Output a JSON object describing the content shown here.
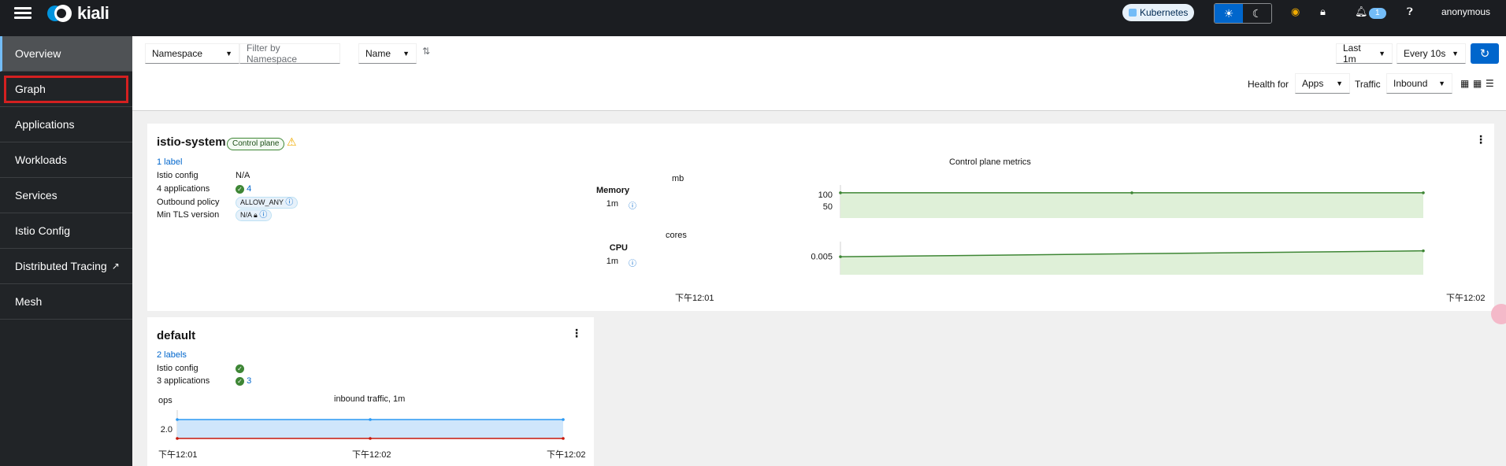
{
  "masthead": {
    "brand": "kiali",
    "cluster_badge": "Kubernetes",
    "notifications_count": "1",
    "username": "anonymous",
    "icons": [
      "menu-icon",
      "sun-icon",
      "moon-icon",
      "status-icon",
      "lock-icon",
      "bell-icon",
      "help-icon"
    ]
  },
  "sidebar": {
    "items": [
      {
        "label": "Overview"
      },
      {
        "label": "Graph"
      },
      {
        "label": "Applications"
      },
      {
        "label": "Workloads"
      },
      {
        "label": "Services"
      },
      {
        "label": "Istio Config"
      },
      {
        "label": "Distributed Tracing"
      },
      {
        "label": "Mesh"
      }
    ],
    "active": "Overview"
  },
  "toolbar": {
    "filter_type": "Namespace",
    "filter_placeholder": "Filter by Namespace",
    "sort_by": "Name",
    "time_range": "Last 1m",
    "refresh_interval": "Every 10s",
    "health_for_label": "Health for",
    "health_for_value": "Apps",
    "traffic_label": "Traffic",
    "traffic_value": "Inbound"
  },
  "cards": {
    "istio_system": {
      "name": "istio-system",
      "badge": "Control plane",
      "labels_link": "1 label",
      "istio_config_label": "Istio config",
      "istio_config_value": "N/A",
      "applications_label": "4 applications",
      "applications_value": "4",
      "outbound_policy_label": "Outbound policy",
      "outbound_policy_value": "ALLOW_ANY",
      "min_tls_label": "Min TLS version",
      "min_tls_value": "N/A",
      "chart_title": "Control plane metrics",
      "memory_label": "Memory",
      "memory_period": "1m",
      "memory_unit": "mb",
      "cpu_label": "CPU",
      "cpu_period": "1m",
      "cpu_unit": "cores",
      "x_start": "下午12:01",
      "x_end": "下午12:02"
    },
    "default": {
      "name": "default",
      "labels_link": "2 labels",
      "istio_config_label": "Istio config",
      "applications_label": "3 applications",
      "applications_value": "3",
      "chart_title": "inbound traffic, 1m",
      "y_unit": "ops",
      "x_start": "下午12:01",
      "x_mid": "下午12:02",
      "x_end": "下午12:02"
    }
  },
  "chart_data": [
    {
      "type": "area",
      "title": "Memory",
      "ylabel": "mb",
      "y_ticks": [
        "100",
        "50"
      ],
      "ylim": [
        0,
        140
      ],
      "x": [
        "下午12:01",
        "下午12:02"
      ],
      "series": [
        {
          "values": [
            107,
            107,
            107
          ]
        }
      ],
      "color": "#3e8635"
    },
    {
      "type": "area",
      "title": "CPU",
      "ylabel": "cores",
      "y_ticks": [
        "0.005"
      ],
      "ylim": [
        0,
        0.009
      ],
      "x": [
        "下午12:01",
        "下午12:02"
      ],
      "series": [
        {
          "values": [
            0.0049,
            0.0065
          ]
        }
      ],
      "color": "#3e8635"
    },
    {
      "type": "area",
      "title": "inbound traffic, 1m",
      "ylabel": "ops",
      "y_ticks": [
        "2.0"
      ],
      "ylim": [
        0,
        3.0
      ],
      "x": [
        "下午12:01",
        "下午12:02",
        "下午12:02"
      ],
      "series": [
        {
          "values": [
            2.0,
            2.0,
            2.0
          ],
          "color": "#2b9af3"
        },
        {
          "values": [
            0,
            0,
            0
          ],
          "color": "#c9190b"
        }
      ]
    }
  ]
}
